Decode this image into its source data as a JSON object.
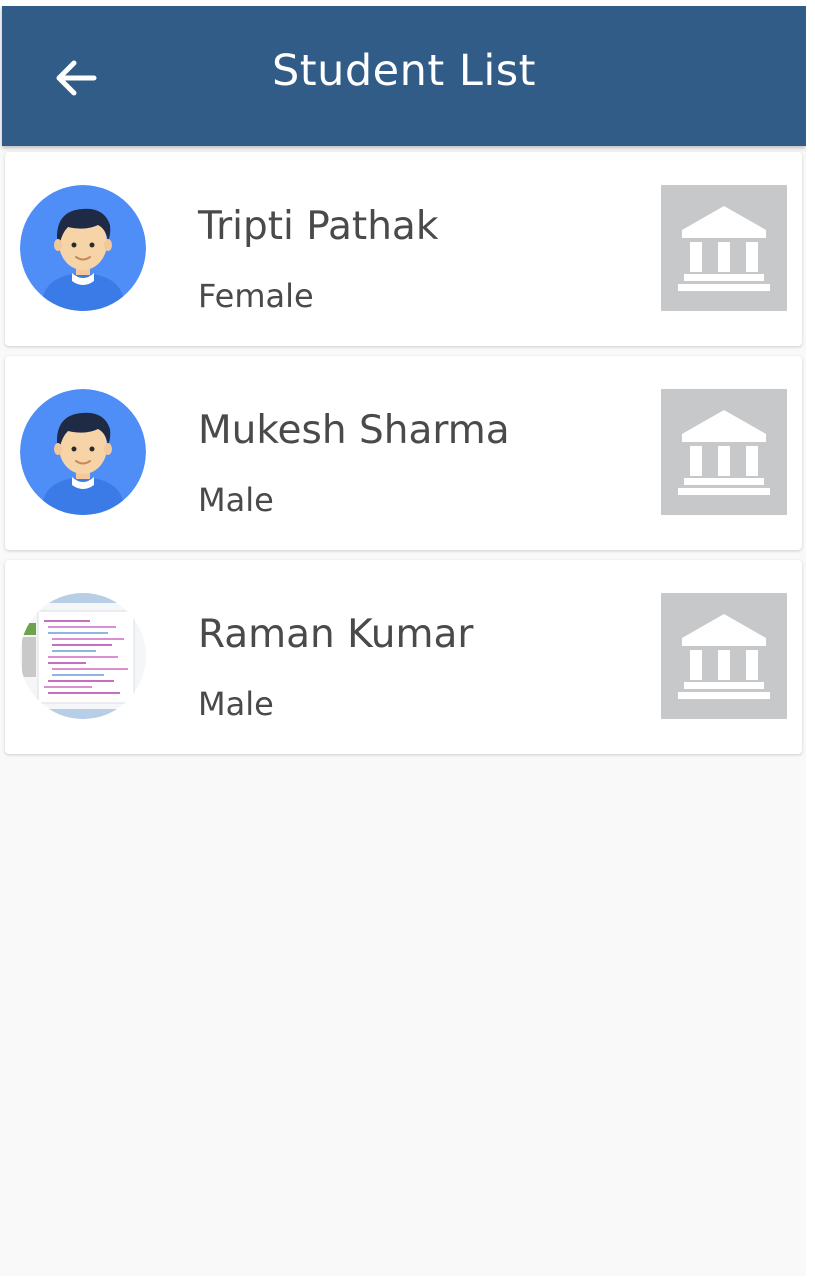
{
  "app": {
    "title": "Student List",
    "header_color": "#305c87",
    "back_icon": "arrow-left-icon"
  },
  "students": [
    {
      "name": "Tripti Pathak",
      "gender": "Female",
      "avatar": "boy-avatar-icon",
      "action_icon": "bank-building-icon"
    },
    {
      "name": "Mukesh Sharma",
      "gender": "Male",
      "avatar": "boy-avatar-icon",
      "action_icon": "bank-building-icon"
    },
    {
      "name": "Raman Kumar",
      "gender": "Male",
      "avatar": "photo-thumbnail",
      "action_icon": "bank-building-icon"
    }
  ]
}
